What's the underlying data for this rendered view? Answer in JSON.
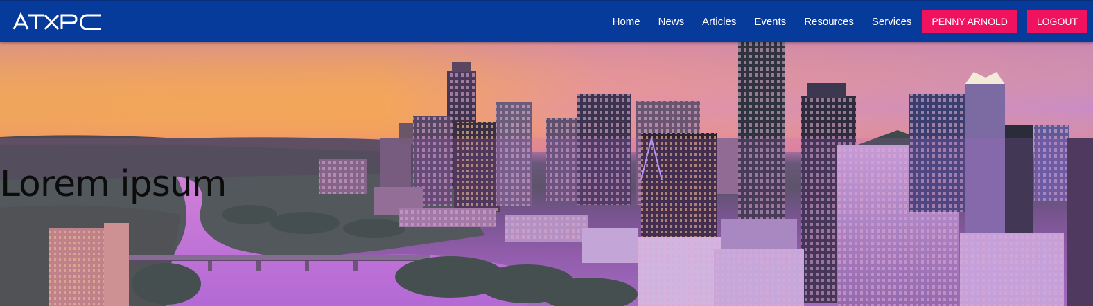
{
  "brand": {
    "name": "ATXPC"
  },
  "nav": {
    "links": [
      "Home",
      "News",
      "Articles",
      "Events",
      "Resources",
      "Services"
    ],
    "user_button": "PENNY ARNOLD",
    "logout_button": "LOGOUT"
  },
  "hero": {
    "title": "Lorem ipsum",
    "image_subject": "Austin city skyline at sunset over river"
  },
  "colors": {
    "navbar": "#063a9b",
    "button": "#f0125f",
    "text_light": "#ffffff"
  }
}
